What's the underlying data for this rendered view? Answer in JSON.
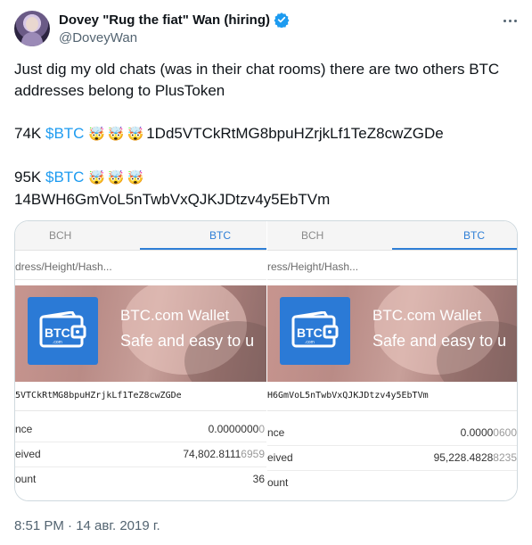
{
  "author": {
    "display_name": "Dovey \"Rug the fiat\" Wan (hiring)",
    "handle": "@DoveyWan",
    "verified": true
  },
  "tweet": {
    "line1": "Just dig my old chats (was in their chat rooms) there are two others BTC addresses belong to PlusToken",
    "p2_amount": "74K ",
    "p2_cashtag": "$BTC",
    "p2_emojis": "🤯🤯🤯",
    "p2_address": "1Dd5VTCkRtMG8bpuHZrjkLf1TeZ8cwZGDe",
    "p3_amount": "95K ",
    "p3_cashtag": "$BTC",
    "p3_emojis": "🤯🤯🤯",
    "p3_address": "14BWH6GmVoL5nTwbVxQJKJDtzv4y5EbTVm",
    "timestamp": "8:51 PM · 14 авг. 2019 г."
  },
  "screenshots": [
    {
      "tab_bch": "BCH",
      "tab_btc": "BTC",
      "search_text": "dress/Height/Hash...",
      "banner_title": "BTC.com Wallet",
      "banner_subtitle": "Safe and easy to u",
      "logo_text": "BTC",
      "logo_subtext": ".com",
      "address": "5VTCkRtMG8bpuHZrjkLf1TeZ8cwZGDe",
      "rows": [
        {
          "label": "nce",
          "value_main": "0.0000000",
          "value_fade": "0"
        },
        {
          "label": "eived",
          "value_main": "74,802.8111",
          "value_fade": "6959"
        },
        {
          "label": "ount",
          "value_main": "36",
          "value_fade": ""
        }
      ]
    },
    {
      "tab_bch": "BCH",
      "tab_btc": "BTC",
      "search_text": "ress/Height/Hash...",
      "banner_title": "BTC.com Wallet",
      "banner_subtitle": "Safe and easy to u",
      "logo_text": "BTC",
      "logo_subtext": ".com",
      "address": "H6GmVoL5nTwbVxQJKJDtzv4y5EbTVm",
      "rows": [
        {
          "label": "nce",
          "value_main": "0.0000",
          "value_fade": "0600"
        },
        {
          "label": "eived",
          "value_main": "95,228.4828",
          "value_fade": "8235"
        },
        {
          "label": "ount",
          "value_main": "",
          "value_fade": ""
        }
      ]
    }
  ],
  "colors": {
    "link": "#1d9bf0",
    "verified": "#1d9bf0",
    "secondary_text": "#536471",
    "app_tab_active": "#2f7fd6",
    "wallet_logo": "#2b7ad6"
  },
  "icons": {
    "verified": "verified-badge-icon",
    "more": "more-horizontal-icon",
    "wallet": "wallet-icon"
  }
}
